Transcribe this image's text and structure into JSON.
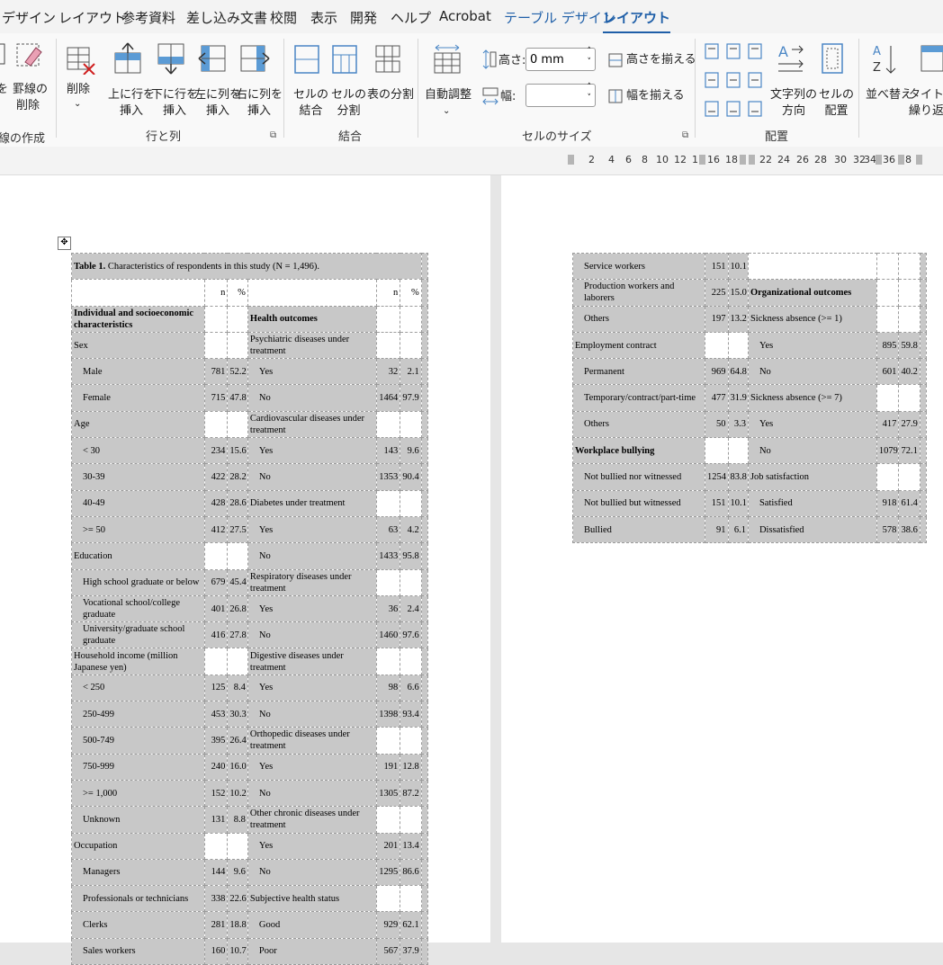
{
  "tabs": [
    "デザイン",
    "レイアウト",
    "参考資料",
    "差し込み文書",
    "校閲",
    "表示",
    "開発",
    "ヘルプ",
    "Acrobat",
    "テーブル デザイン",
    "レイアウト"
  ],
  "ribbon": {
    "draw": {
      "eraser": "罫線の\n削除",
      "group": "線の作成",
      "left_frag": "を"
    },
    "rows_cols": {
      "delete": "削除",
      "insert_above": "上に行を\n挿入",
      "insert_below": "下に行を\n挿入",
      "insert_left": "左に列を\n挿入",
      "insert_right": "右に列を\n挿入",
      "group": "行と列"
    },
    "merge": {
      "merge_cells": "セルの\n結合",
      "split_cells": "セルの\n分割",
      "split_table": "表の分割",
      "group": "結合"
    },
    "cell_size": {
      "autofit": "自動調整",
      "height_label": "高さ:",
      "height_value": "0 mm",
      "width_label": "幅:",
      "width_value": "",
      "distribute_rows": "高さを揃える",
      "distribute_cols": "幅を揃える",
      "group": "セルのサイズ"
    },
    "alignment": {
      "text_direction": "文字列の\n方向",
      "cell_margins": "セルの\n配置",
      "group": "配置"
    },
    "data": {
      "sort": "並べ替え",
      "repeat_header": "タイトル行\n繰り返"
    }
  },
  "ruler": [
    "2",
    "4",
    "6",
    "8",
    "10",
    "12",
    "1",
    "16",
    "18",
    "22",
    "24",
    "26",
    "28",
    "30",
    "32",
    "34",
    "36",
    "8"
  ],
  "table1": {
    "caption_bold": "Table 1.",
    "caption_rest": " Characteristics of respondents in this study (N = 1,496).",
    "hdr_n": "n",
    "hdr_pct": "%",
    "rows": [
      [
        "Individual and socioeconomic characteristics",
        "",
        "",
        "Health outcomes",
        "",
        ""
      ],
      [
        "Sex",
        "",
        "",
        "Psychiatric diseases under treatment",
        "",
        ""
      ],
      [
        "Male",
        "781",
        "52.2",
        "Yes",
        "32",
        "2.1"
      ],
      [
        "Female",
        "715",
        "47.8",
        "No",
        "1464",
        "97.9"
      ],
      [
        "Age",
        "",
        "",
        "Cardiovascular diseases under treatment",
        "",
        ""
      ],
      [
        "< 30",
        "234",
        "15.6",
        "Yes",
        "143",
        "9.6"
      ],
      [
        "30-39",
        "422",
        "28.2",
        "No",
        "1353",
        "90.4"
      ],
      [
        "40-49",
        "428",
        "28.6",
        "Diabetes under treatment",
        "",
        ""
      ],
      [
        ">= 50",
        "412",
        "27.5",
        "Yes",
        "63",
        "4.2"
      ],
      [
        "Education",
        "",
        "",
        "No",
        "1433",
        "95.8"
      ],
      [
        "High school graduate or below",
        "679",
        "45.4",
        "Respiratory diseases under treatment",
        "",
        ""
      ],
      [
        "Vocational school/college graduate",
        "401",
        "26.8",
        "Yes",
        "36",
        "2.4"
      ],
      [
        "University/graduate school graduate",
        "416",
        "27.8",
        "No",
        "1460",
        "97.6"
      ],
      [
        "Household income (million Japanese yen)",
        "",
        "",
        "Digestive diseases under treatment",
        "",
        ""
      ],
      [
        "< 250",
        "125",
        "8.4",
        "Yes",
        "98",
        "6.6"
      ],
      [
        "250-499",
        "453",
        "30.3",
        "No",
        "1398",
        "93.4"
      ],
      [
        "500-749",
        "395",
        "26.4",
        "Orthopedic diseases under treatment",
        "",
        ""
      ],
      [
        "750-999",
        "240",
        "16.0",
        "Yes",
        "191",
        "12.8"
      ],
      [
        ">= 1,000",
        "152",
        "10.2",
        "No",
        "1305",
        "87.2"
      ],
      [
        "Unknown",
        "131",
        "8.8",
        "Other chronic diseases under treatment",
        "",
        ""
      ],
      [
        "Occupation",
        "",
        "",
        "Yes",
        "201",
        "13.4"
      ],
      [
        "Managers",
        "144",
        "9.6",
        "No",
        "1295",
        "86.6"
      ],
      [
        "Professionals or technicians",
        "338",
        "22.6",
        "Subjective health status",
        "",
        ""
      ],
      [
        "Clerks",
        "281",
        "18.8",
        "Good",
        "929",
        "62.1"
      ],
      [
        "Sales workers",
        "160",
        "10.7",
        "Poor",
        "567",
        "37.9"
      ]
    ]
  },
  "table2": {
    "rows": [
      [
        "Service workers",
        "151",
        "10.1",
        "",
        "",
        ""
      ],
      [
        "Production workers and laborers",
        "225",
        "15.0",
        "Organizational outcomes",
        "",
        ""
      ],
      [
        "Others",
        "197",
        "13.2",
        "Sickness absence (>= 1)",
        "",
        ""
      ],
      [
        "Employment contract",
        "",
        "",
        "Yes",
        "895",
        "59.8"
      ],
      [
        "Permanent",
        "969",
        "64.8",
        "No",
        "601",
        "40.2"
      ],
      [
        "Temporary/contract/part-time",
        "477",
        "31.9",
        "Sickness absence (>= 7)",
        "",
        ""
      ],
      [
        "Others",
        "50",
        "3.3",
        "Yes",
        "417",
        "27.9"
      ],
      [
        "Workplace bullying",
        "",
        "",
        "No",
        "1079",
        "72.1"
      ],
      [
        "Not bullied nor witnessed",
        "1254",
        "83.8",
        "Job satisfaction",
        "",
        ""
      ],
      [
        "Not bullied but witnessed",
        "151",
        "10.1",
        "Satisfied",
        "918",
        "61.4"
      ],
      [
        "Bullied",
        "91",
        "6.1",
        "Dissatisfied",
        "578",
        "38.6"
      ]
    ]
  }
}
